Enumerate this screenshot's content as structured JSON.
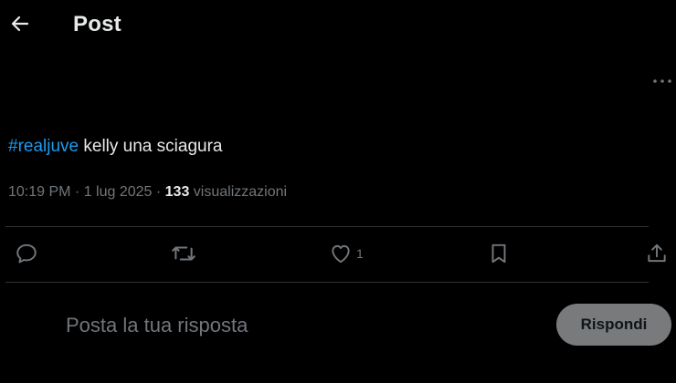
{
  "header": {
    "title": "Post",
    "back_icon": "arrow-left-icon"
  },
  "post": {
    "hashtag": "#realjuve",
    "text": " kelly una sciagura",
    "time": "10:19 PM",
    "date": "1 lug 2025",
    "separator": " · ",
    "views_count": "133",
    "views_label": " visualizzazioni",
    "more_icon": "more-options-icon"
  },
  "actions": {
    "reply_icon": "reply-icon",
    "retweet_icon": "retweet-icon",
    "like_icon": "heart-icon",
    "like_count": "1",
    "bookmark_icon": "bookmark-icon",
    "share_icon": "share-icon"
  },
  "reply": {
    "placeholder": "Posta la tua risposta",
    "button_label": "Rispondi"
  },
  "colors": {
    "background": "#000000",
    "text": "#e7e9ea",
    "muted": "#71767b",
    "accent": "#1d9bf0",
    "divider": "#2f3336",
    "button_bg": "#787a7c"
  }
}
